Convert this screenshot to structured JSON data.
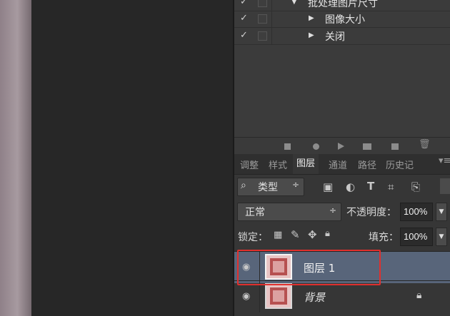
{
  "actions_panel": {
    "rows": [
      {
        "check": "✓",
        "indent": 1,
        "triangle": "▼",
        "label": "批处理图片尺寸"
      },
      {
        "check": "✓",
        "indent": 2,
        "triangle": "▶",
        "label": "图像大小"
      },
      {
        "check": "✓",
        "indent": 2,
        "triangle": "▶",
        "label": "关闭"
      }
    ],
    "toolbar_icons": [
      "stop-icon",
      "record-icon",
      "play-icon",
      "folder-icon",
      "new-action-icon",
      "trash-icon"
    ]
  },
  "layers_panel": {
    "tabs": [
      "调整",
      "样式",
      "图层",
      "通道",
      "路径",
      "历史记"
    ],
    "active_tab": "图层",
    "filter": {
      "search_glyph": "⌕",
      "value": "类型",
      "stepper": "÷"
    },
    "blend_mode": {
      "value": "正常",
      "stepper": "÷"
    },
    "opacity": {
      "label": "不透明度：",
      "value": "100%"
    },
    "lock": {
      "label": "锁定："
    },
    "fill": {
      "label": "填充：",
      "value": "100%"
    },
    "layers": [
      {
        "name": "图层 1",
        "selected": true,
        "visible": true,
        "locked": false
      },
      {
        "name": "背景",
        "selected": false,
        "visible": true,
        "locked": true
      }
    ]
  },
  "colors": {
    "panel_bg": "#363636",
    "selected_row": "#58657a",
    "annotation_border": "#e0302e"
  }
}
